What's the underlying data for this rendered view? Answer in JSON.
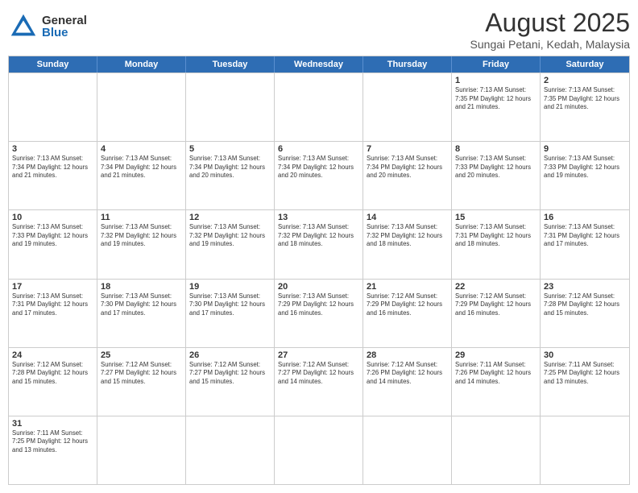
{
  "logo": {
    "general": "General",
    "blue": "Blue"
  },
  "title": {
    "month_year": "August 2025",
    "location": "Sungai Petani, Kedah, Malaysia"
  },
  "header_days": [
    "Sunday",
    "Monday",
    "Tuesday",
    "Wednesday",
    "Thursday",
    "Friday",
    "Saturday"
  ],
  "weeks": [
    [
      {
        "day": "",
        "info": ""
      },
      {
        "day": "",
        "info": ""
      },
      {
        "day": "",
        "info": ""
      },
      {
        "day": "",
        "info": ""
      },
      {
        "day": "",
        "info": ""
      },
      {
        "day": "1",
        "info": "Sunrise: 7:13 AM\nSunset: 7:35 PM\nDaylight: 12 hours and 21 minutes."
      },
      {
        "day": "2",
        "info": "Sunrise: 7:13 AM\nSunset: 7:35 PM\nDaylight: 12 hours and 21 minutes."
      }
    ],
    [
      {
        "day": "3",
        "info": "Sunrise: 7:13 AM\nSunset: 7:34 PM\nDaylight: 12 hours and 21 minutes."
      },
      {
        "day": "4",
        "info": "Sunrise: 7:13 AM\nSunset: 7:34 PM\nDaylight: 12 hours and 21 minutes."
      },
      {
        "day": "5",
        "info": "Sunrise: 7:13 AM\nSunset: 7:34 PM\nDaylight: 12 hours and 20 minutes."
      },
      {
        "day": "6",
        "info": "Sunrise: 7:13 AM\nSunset: 7:34 PM\nDaylight: 12 hours and 20 minutes."
      },
      {
        "day": "7",
        "info": "Sunrise: 7:13 AM\nSunset: 7:34 PM\nDaylight: 12 hours and 20 minutes."
      },
      {
        "day": "8",
        "info": "Sunrise: 7:13 AM\nSunset: 7:33 PM\nDaylight: 12 hours and 20 minutes."
      },
      {
        "day": "9",
        "info": "Sunrise: 7:13 AM\nSunset: 7:33 PM\nDaylight: 12 hours and 19 minutes."
      }
    ],
    [
      {
        "day": "10",
        "info": "Sunrise: 7:13 AM\nSunset: 7:33 PM\nDaylight: 12 hours and 19 minutes."
      },
      {
        "day": "11",
        "info": "Sunrise: 7:13 AM\nSunset: 7:32 PM\nDaylight: 12 hours and 19 minutes."
      },
      {
        "day": "12",
        "info": "Sunrise: 7:13 AM\nSunset: 7:32 PM\nDaylight: 12 hours and 19 minutes."
      },
      {
        "day": "13",
        "info": "Sunrise: 7:13 AM\nSunset: 7:32 PM\nDaylight: 12 hours and 18 minutes."
      },
      {
        "day": "14",
        "info": "Sunrise: 7:13 AM\nSunset: 7:32 PM\nDaylight: 12 hours and 18 minutes."
      },
      {
        "day": "15",
        "info": "Sunrise: 7:13 AM\nSunset: 7:31 PM\nDaylight: 12 hours and 18 minutes."
      },
      {
        "day": "16",
        "info": "Sunrise: 7:13 AM\nSunset: 7:31 PM\nDaylight: 12 hours and 17 minutes."
      }
    ],
    [
      {
        "day": "17",
        "info": "Sunrise: 7:13 AM\nSunset: 7:31 PM\nDaylight: 12 hours and 17 minutes."
      },
      {
        "day": "18",
        "info": "Sunrise: 7:13 AM\nSunset: 7:30 PM\nDaylight: 12 hours and 17 minutes."
      },
      {
        "day": "19",
        "info": "Sunrise: 7:13 AM\nSunset: 7:30 PM\nDaylight: 12 hours and 17 minutes."
      },
      {
        "day": "20",
        "info": "Sunrise: 7:13 AM\nSunset: 7:29 PM\nDaylight: 12 hours and 16 minutes."
      },
      {
        "day": "21",
        "info": "Sunrise: 7:12 AM\nSunset: 7:29 PM\nDaylight: 12 hours and 16 minutes."
      },
      {
        "day": "22",
        "info": "Sunrise: 7:12 AM\nSunset: 7:29 PM\nDaylight: 12 hours and 16 minutes."
      },
      {
        "day": "23",
        "info": "Sunrise: 7:12 AM\nSunset: 7:28 PM\nDaylight: 12 hours and 15 minutes."
      }
    ],
    [
      {
        "day": "24",
        "info": "Sunrise: 7:12 AM\nSunset: 7:28 PM\nDaylight: 12 hours and 15 minutes."
      },
      {
        "day": "25",
        "info": "Sunrise: 7:12 AM\nSunset: 7:27 PM\nDaylight: 12 hours and 15 minutes."
      },
      {
        "day": "26",
        "info": "Sunrise: 7:12 AM\nSunset: 7:27 PM\nDaylight: 12 hours and 15 minutes."
      },
      {
        "day": "27",
        "info": "Sunrise: 7:12 AM\nSunset: 7:27 PM\nDaylight: 12 hours and 14 minutes."
      },
      {
        "day": "28",
        "info": "Sunrise: 7:12 AM\nSunset: 7:26 PM\nDaylight: 12 hours and 14 minutes."
      },
      {
        "day": "29",
        "info": "Sunrise: 7:11 AM\nSunset: 7:26 PM\nDaylight: 12 hours and 14 minutes."
      },
      {
        "day": "30",
        "info": "Sunrise: 7:11 AM\nSunset: 7:25 PM\nDaylight: 12 hours and 13 minutes."
      }
    ],
    [
      {
        "day": "31",
        "info": "Sunrise: 7:11 AM\nSunset: 7:25 PM\nDaylight: 12 hours and 13 minutes."
      },
      {
        "day": "",
        "info": ""
      },
      {
        "day": "",
        "info": ""
      },
      {
        "day": "",
        "info": ""
      },
      {
        "day": "",
        "info": ""
      },
      {
        "day": "",
        "info": ""
      },
      {
        "day": "",
        "info": ""
      }
    ]
  ]
}
